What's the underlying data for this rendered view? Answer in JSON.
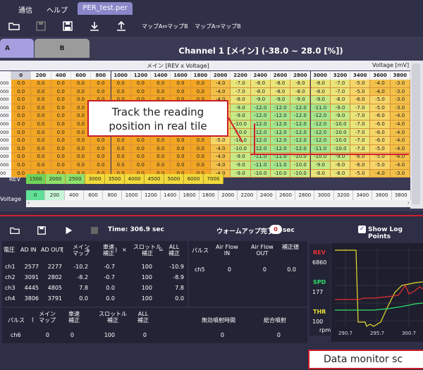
{
  "menu": {
    "items": [
      "通信",
      "ヘルプ"
    ],
    "file_tab": "PER_test.per"
  },
  "toolbar": {
    "btn_map_copy_ab": "マップA⇔マップB",
    "btn_map_copy_a_to_b": "マップA⇒マップB"
  },
  "tabs": {
    "a": "A",
    "b": "B"
  },
  "channel_title": "Channel 1 [メイン] (-38.0 ~ 28.0 [%])",
  "map": {
    "header_title": "メイン [REV x Voltage]",
    "header_unit": "Voltage [mV]",
    "corner": "0",
    "columns": [
      "0",
      "200",
      "400",
      "600",
      "800",
      "1000",
      "1200",
      "1400",
      "1600",
      "1800",
      "2000",
      "2200",
      "2400",
      "2600",
      "2800",
      "3000",
      "3200",
      "3400",
      "3600",
      "3800"
    ],
    "row_labels": [
      "000",
      "000",
      "000",
      "000",
      "000",
      "000",
      "000",
      "000",
      "000",
      "000",
      "000",
      "00"
    ],
    "rows": [
      [
        "0.0",
        "0.0",
        "0.0",
        "0.0",
        "0.0",
        "0.0",
        "0.0",
        "0.0",
        "0.0",
        "0.0",
        "-4.0",
        "-7.0",
        "-8.0",
        "-8.0",
        "-8.0",
        "-8.0",
        "-7.0",
        "-5.0",
        "-4.0",
        "-3.0"
      ],
      [
        "0.0",
        "0.0",
        "0.0",
        "0.0",
        "0.0",
        "0.0",
        "0.0",
        "0.0",
        "0.0",
        "0.0",
        "-4.0",
        "-7.0",
        "-8.0",
        "-8.0",
        "-8.0",
        "-8.0",
        "-7.0",
        "-5.0",
        "-4.0",
        "-3.0"
      ],
      [
        "0.0",
        "0.0",
        "0.0",
        "0.0",
        "0.0",
        "0.0",
        "0.0",
        "0.0",
        "0.0",
        "0.0",
        "-4.0",
        "-8.0",
        "-9.0",
        "-9.0",
        "-9.0",
        "-9.0",
        "-8.0",
        "-6.0",
        "-5.0",
        "-3.0"
      ],
      [
        "0.0",
        "0.0",
        "0.0",
        "0.0",
        "0.0",
        "0.0",
        "0.0",
        "0.0",
        "0.0",
        "0.0",
        "-5.0",
        "-9.0",
        "-12.0",
        "-12.0",
        "-12.0",
        "-11.0",
        "-9.0",
        "-7.0",
        "-5.0",
        "-3.0"
      ],
      [
        "0.0",
        "0.0",
        "0.0",
        "0.0",
        "0.0",
        "0.0",
        "0.0",
        "0.0",
        "0.0",
        "0.0",
        "-5.0",
        "-9.0",
        "-12.0",
        "-12.0",
        "-12.0",
        "-12.0",
        "-9.0",
        "-7.0",
        "-6.0",
        "-4.0"
      ],
      [
        "0.0",
        "0.0",
        "0.0",
        "0.0",
        "0.0",
        "0.0",
        "0.0",
        "0.0",
        "0.0",
        "0.0",
        "-5.0",
        "-10.0",
        "-12.0",
        "-12.0",
        "-12.0",
        "-12.0",
        "-10.0",
        "-7.0",
        "-6.0",
        "-4.0"
      ],
      [
        "0.0",
        "0.0",
        "0.0",
        "0.0",
        "0.0",
        "0.0",
        "0.0",
        "0.0",
        "0.0",
        "0.0",
        "-5.0",
        "-10.0",
        "-12.0",
        "-12.0",
        "-12.0",
        "-12.0",
        "-10.0",
        "-7.0",
        "-6.0",
        "-4.0"
      ],
      [
        "0.0",
        "0.0",
        "0.0",
        "0.0",
        "0.0",
        "0.0",
        "0.0",
        "0.0",
        "0.0",
        "0.0",
        "-5.0",
        "-10.0",
        "-12.0",
        "-12.0",
        "-12.0",
        "-12.0",
        "-10.0",
        "-7.0",
        "-6.0",
        "-4.0"
      ],
      [
        "0.0",
        "0.0",
        "0.0",
        "0.0",
        "0.0",
        "0.0",
        "0.0",
        "0.0",
        "0.0",
        "0.0",
        "-4.0",
        "-10.0",
        "-12.0",
        "-12.0",
        "-12.0",
        "-11.0",
        "-10.0",
        "-7.0",
        "-5.0",
        "-4.0"
      ],
      [
        "0.0",
        "0.0",
        "0.0",
        "0.0",
        "0.0",
        "0.0",
        "0.0",
        "0.0",
        "0.0",
        "0.0",
        "-4.0",
        "-9.0",
        "-11.0",
        "-11.0",
        "-10.0",
        "-10.0",
        "-9.0",
        "-6.0",
        "-5.0",
        "-4.0"
      ],
      [
        "0.0",
        "0.0",
        "0.0",
        "0.0",
        "0.0",
        "0.0",
        "0.0",
        "0.0",
        "0.0",
        "0.0",
        "-4.0",
        "-9.0",
        "-11.0",
        "-11.0",
        "-10.0",
        "-9.0",
        "-8.0",
        "-6.0",
        "-5.0",
        "-4.0"
      ],
      [
        "0.0",
        "0.0",
        "0.0",
        "0.0",
        "0.0",
        "0.0",
        "0.0",
        "0.0",
        "0.0",
        "0.0",
        "-4.0",
        "-9.0",
        "-10.0",
        "-10.0",
        "-10.0",
        "-8.0",
        "-8.0",
        "-5.0",
        "-4.0",
        "-3.0"
      ]
    ]
  },
  "rev": {
    "label": "REV",
    "values": [
      "1500",
      "2000",
      "2500",
      "3000",
      "3500",
      "4000",
      "4500",
      "5000",
      "6000",
      "7000"
    ]
  },
  "voltage": {
    "label": "Voltage",
    "values": [
      "0",
      "200",
      "400",
      "600",
      "800",
      "1000",
      "1200",
      "1400",
      "1600",
      "1800",
      "2000",
      "2200",
      "2400",
      "2600",
      "2800",
      "3000",
      "3200",
      "3400",
      "3600",
      "3800"
    ]
  },
  "callout1": {
    "line1": "Track the reading",
    "line2": "position in real tile"
  },
  "monitor": {
    "time": "Time: 306.9 sec",
    "warmup_label": "ウォームアップ完了",
    "warmup_value": "0",
    "warmup_unit": "sec",
    "show_log": "Show Log Points",
    "table_headers": [
      "電圧",
      "AD IN",
      "AD OUT",
      "(",
      "メイン\nマップ",
      "+",
      "車速\n補正",
      ")",
      "×",
      "スロットル\n補正",
      "=",
      "ALL\n補正"
    ],
    "rows": [
      {
        "ch": "ch1",
        "adin": "2577",
        "adout": "2277",
        "main": "-10.2",
        "spd": "-0.7",
        "thr": "100",
        "all": "-10.9"
      },
      {
        "ch": "ch2",
        "adin": "3091",
        "adout": "2802",
        "main": "-8.2",
        "spd": "-0.7",
        "thr": "100",
        "all": "-8.9"
      },
      {
        "ch": "ch3",
        "adin": "4445",
        "adout": "4805",
        "main": "7.8",
        "spd": "0.0",
        "thr": "100",
        "all": "7.8"
      },
      {
        "ch": "ch4",
        "adin": "3806",
        "adout": "3791",
        "main": "0.0",
        "spd": "0.0",
        "thr": "100",
        "all": "0.0"
      }
    ],
    "pulse_header": {
      "label": "パルス",
      "airin": "Air Flow\nIN",
      "airout": "Air Flow\nOUT",
      "corr": "補正値"
    },
    "pulse_row": {
      "ch": "ch5",
      "airin": "0",
      "airout": "0",
      "corr": "0.0"
    },
    "pulse2_header": {
      "label": "パルス",
      "main": "メイン\nマップ",
      "spd": "車速\n補正",
      "thr": "スロットル\n補正",
      "all": "ALL\n補正",
      "invalid": "無効噴射時間",
      "total": "総合噴射"
    },
    "pulse2_row": {
      "ch": "ch6",
      "main": "0",
      "spd": "0",
      "thr": "100",
      "all": "0",
      "invalid": "0",
      "total": "0"
    },
    "gauges": [
      {
        "name": "REV",
        "value": "6860",
        "color": "#e83030"
      },
      {
        "name": "SPD",
        "value": "177",
        "color": "#2ee06a"
      },
      {
        "name": "THR",
        "value": "100",
        "color": "#e6e030"
      }
    ],
    "gauge_unit": "rpm",
    "chart_x": [
      "290.7",
      "295.7",
      "300.7"
    ]
  },
  "callout2": {
    "text": "Data monitor sc"
  }
}
